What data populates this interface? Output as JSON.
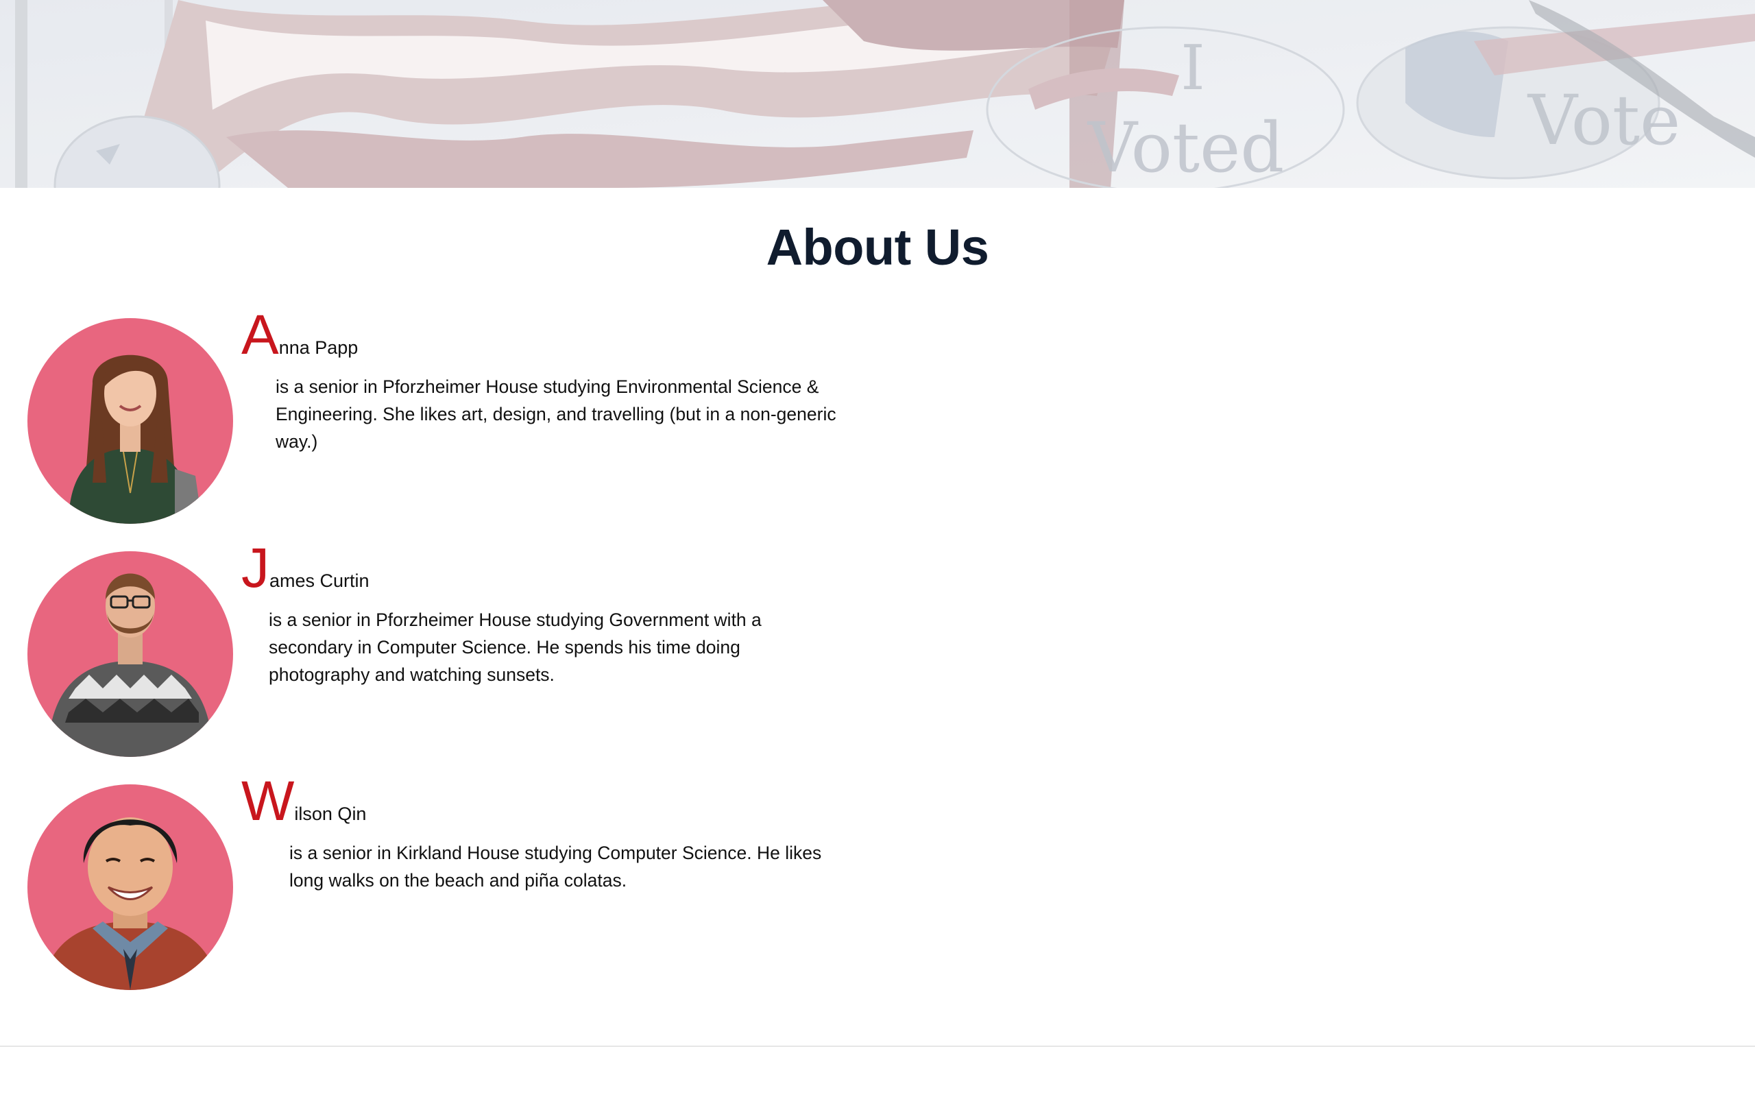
{
  "hero": {
    "image": "american-flag-i-voted-banner",
    "button_text_large": "I",
    "button_text_voted": "Voted",
    "button_text_right": "Vote"
  },
  "page": {
    "title": "About Us"
  },
  "members": [
    {
      "initial": "A",
      "name_rest": "nna Papp",
      "bio": "is a senior in Pforzheimer House studying Environmental Science & Engineering. She likes art, design, and travelling (but in a non-generic way.)"
    },
    {
      "initial": "J",
      "name_rest": "ames Curtin",
      "bio": "is a senior in Pforzheimer House studying Government with a secondary in Computer Science. He spends his time doing photography and watching sunsets."
    },
    {
      "initial": "W",
      "name_rest": "ilson Qin",
      "bio": "is a senior in Kirkland House studying Computer Science. He likes long walks on the beach and piña colatas."
    }
  ],
  "colors": {
    "accent": "#c8161d",
    "title": "#101c2e",
    "avatar_bg": "#e8667f"
  }
}
